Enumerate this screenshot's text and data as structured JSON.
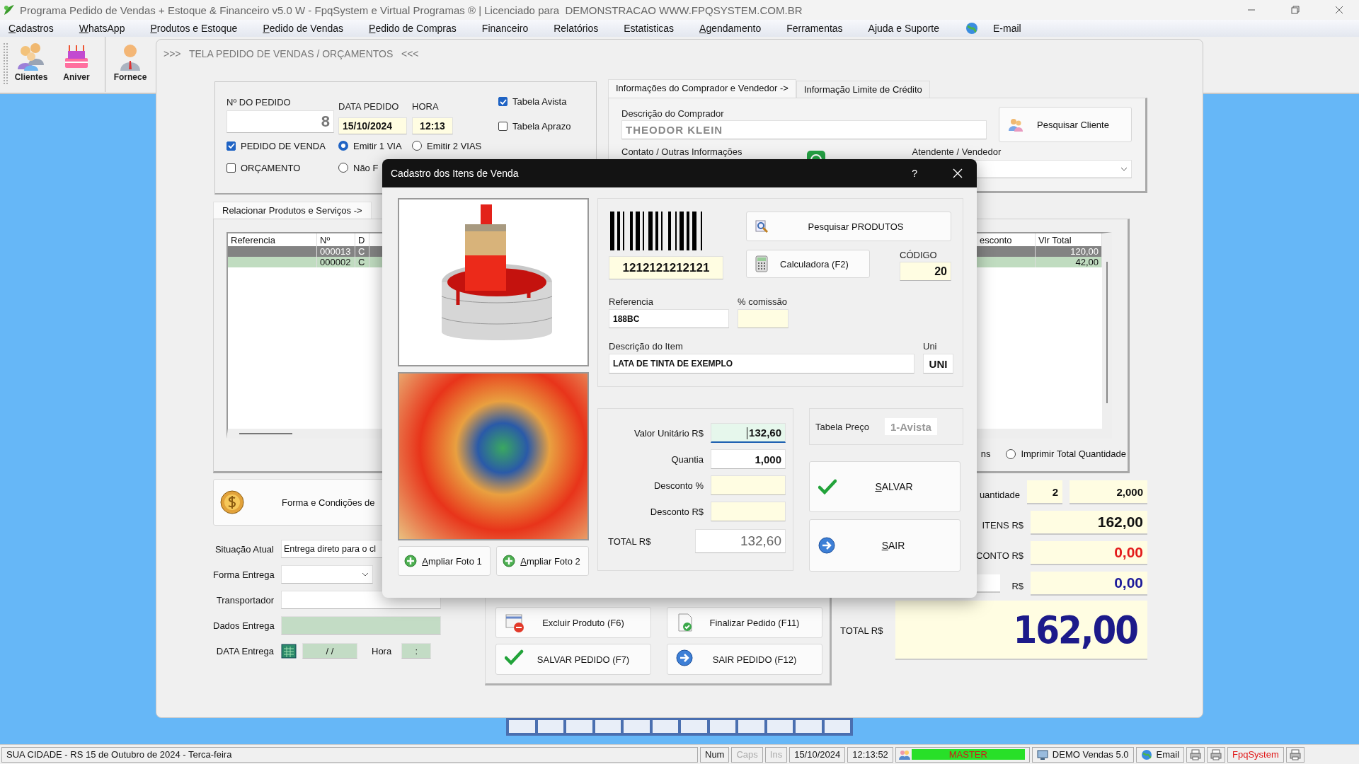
{
  "window": {
    "title": "Programa Pedido de Vendas + Estoque & Financeiro v5.0 W - FpqSystem e Virtual Programas ® | Licenciado para  DEMONSTRACAO WWW.FPQSYSTEM.COM.BR"
  },
  "menu": [
    {
      "label": "Cadastros",
      "access_key": true,
      "kind": "text"
    },
    {
      "label": "WhatsApp",
      "access_key": true,
      "kind": "text"
    },
    {
      "label": "Produtos e Estoque",
      "access_key": true,
      "kind": "text"
    },
    {
      "label": "Pedido de Vendas",
      "access_key": true,
      "kind": "text"
    },
    {
      "label": "Pedido de Compras",
      "access_key": true,
      "kind": "text"
    },
    {
      "label": "Financeiro",
      "access_key": false,
      "kind": "text"
    },
    {
      "label": "Relatórios",
      "access_key": false,
      "kind": "text"
    },
    {
      "label": "Estatisticas",
      "access_key": false,
      "kind": "text"
    },
    {
      "label": "Agendamento",
      "access_key": true,
      "kind": "text"
    },
    {
      "label": "Ferramentas",
      "access_key": false,
      "kind": "text"
    },
    {
      "label": "Ajuda e Suporte",
      "access_key": false,
      "kind": "text"
    },
    {
      "label": "E-mail",
      "access_key": false,
      "kind": "icon"
    }
  ],
  "toolbar": [
    {
      "label": "Clientes"
    },
    {
      "label": "Aniver"
    },
    {
      "label": "Fornece"
    }
  ],
  "form": {
    "header": ">>>   TELA PEDIDO DE VENDAS / ORÇAMENTOS   <<<"
  },
  "order": {
    "number_label": "Nº DO PEDIDO",
    "number": "8",
    "date_label": "DATA PEDIDO",
    "date": "15/10/2024",
    "time_label": "HORA",
    "time": "12:13",
    "checks": [
      {
        "label": "PEDIDO DE VENDA",
        "checked": true
      },
      {
        "label": "ORÇAMENTO",
        "checked": false
      }
    ],
    "via_options": [
      {
        "label": "Emitir 1 VIA",
        "selected": true
      },
      {
        "label": "Emitir 2 VIAS",
        "selected": false
      },
      {
        "label": "Não F",
        "selected": false
      }
    ],
    "price_tables": [
      {
        "label": "Tabela Avista",
        "checked": true
      },
      {
        "label": "Tabela Aprazo",
        "checked": false
      }
    ]
  },
  "buyer_tabs": [
    {
      "label": "Informações do Comprador e Vendedor ->",
      "selected": true
    },
    {
      "label": "Informação Limite de Crédito",
      "selected": false
    }
  ],
  "buyer": {
    "name_label": "Descrição do Comprador",
    "name": "THEODOR KLEIN",
    "search_button": "Pesquisar Cliente",
    "contact_label": "Contato / Outras Informações",
    "seller_label": "Atendente / Vendedor"
  },
  "products_tab": {
    "label": "Relacionar Produtos e Serviços ->",
    "selected": true
  },
  "items_table": {
    "columns": [
      "Referencia",
      "Nº",
      "D"
    ],
    "right_columns": [
      "esconto",
      "Vlr Total"
    ],
    "rows": [
      {
        "number": "000013",
        "column_3": "C",
        "total": "120,00",
        "selected": true
      },
      {
        "number": "000002",
        "column_3": "C",
        "total": "42,00",
        "selected": false
      }
    ]
  },
  "print_options": {
    "cut_label": "ns",
    "label": "Imprimir Total Quantidade",
    "selected": false
  },
  "payment_button": "Forma e Condições de",
  "delivery": {
    "status_label": "Situação Atual",
    "status": "Entrega direto para o cl",
    "method_label": "Forma Entrega",
    "carrier_label": "Transportador",
    "data_label": "Dados Entrega",
    "date_label": "DATA Entrega",
    "date": "/ /",
    "time_label": "Hora",
    "time": ":"
  },
  "actions": [
    {
      "label": "Excluir Produto (F6)"
    },
    {
      "label": "Finalizar Pedido (F11)"
    },
    {
      "label": "SALVAR PEDIDO (F7)"
    },
    {
      "label": "SAIR  PEDIDO (F12)"
    }
  ],
  "totals": {
    "qty_label": "uantidade",
    "qty_count": "2",
    "qty_total": "2,000",
    "items_label": "ITENS R$",
    "items": "162,00",
    "discount_label": "CONTO R$",
    "discount": "0,00",
    "other_label": "R$",
    "other": "0,00",
    "total_label": "TOTAL R$",
    "total": "162,00"
  },
  "dialog": {
    "title": "Cadastro dos Itens de Venda",
    "help": "?",
    "photo_buttons": [
      {
        "label": "Ampliar Foto 1",
        "access_key": true
      },
      {
        "label": "Ampliar Foto 2",
        "access_key": true
      }
    ],
    "barcode": "1212121212121",
    "search_button": "Pesquisar PRODUTOS",
    "calc_button": "Calculadora (F2)",
    "code_label": "CÓDIGO",
    "code": "20",
    "ref_label": "Referencia",
    "ref": "188BC",
    "commission_label": "% comissão",
    "desc_label": "Descrição do Item",
    "desc": "LATA DE TINTA DE EXEMPLO",
    "unit_label": "Uni",
    "unit": "UNI",
    "values": [
      {
        "label": "Valor Unitário R$",
        "value": "132,60",
        "kind": "active"
      },
      {
        "label": "Quantia",
        "value": "1,000",
        "kind": "plain"
      },
      {
        "label": "Desconto %",
        "kind": "optional"
      },
      {
        "label": "Desconto R$",
        "kind": "optional"
      },
      {
        "label": "TOTAL R$",
        "value": "132,60",
        "kind": "total"
      }
    ],
    "price_table_label": "Tabela Preço",
    "price_table": "1-Avista",
    "save": {
      "label": "SALVAR",
      "access_key": true
    },
    "exit": {
      "label": "SAIR",
      "access_key": true
    }
  },
  "status_bar": [
    {
      "text": "SUA CIDADE - RS 15 de Outubro de 2024 - Terca-feira",
      "kind": "text"
    },
    {
      "text": "Num",
      "kind": "key",
      "disabled": false
    },
    {
      "text": "Caps",
      "kind": "key",
      "disabled": true
    },
    {
      "text": "Ins",
      "kind": "key",
      "disabled": true
    },
    {
      "text": "15/10/2024",
      "kind": "plain"
    },
    {
      "text": "12:13:52",
      "kind": "plain"
    },
    {
      "text": "MASTER",
      "kind": "user"
    },
    {
      "text": "DEMO Vendas 5.0",
      "kind": "app"
    },
    {
      "text": "Email",
      "kind": "mail"
    },
    {
      "kind": "icon"
    },
    {
      "kind": "icon"
    },
    {
      "text": "FpqSystem",
      "kind": "brand"
    },
    {
      "kind": "icon"
    }
  ]
}
